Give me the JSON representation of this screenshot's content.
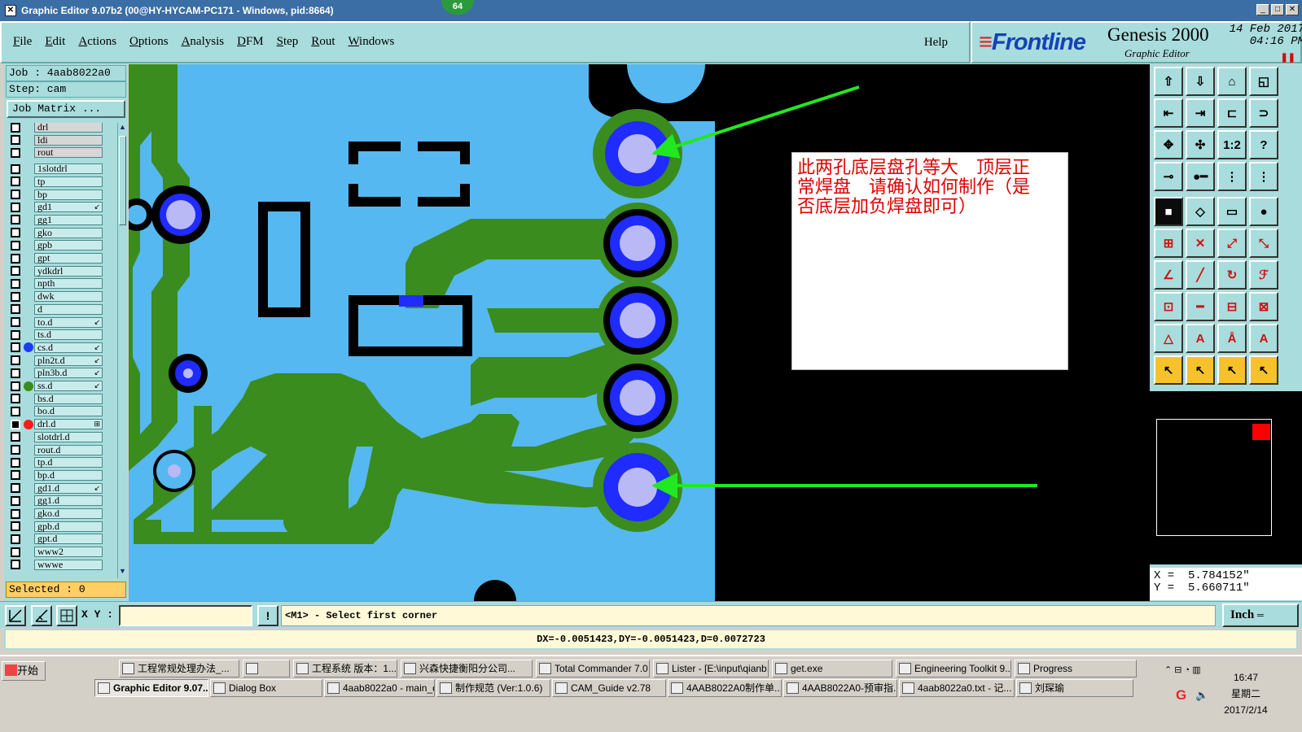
{
  "window": {
    "title": "Graphic Editor 9.07b2 (00@HY-HYCAM-PC171 - Windows, pid:8664)",
    "badge": "64"
  },
  "menu": {
    "items": [
      "File",
      "Edit",
      "Actions",
      "Options",
      "Analysis",
      "DFM",
      "Step",
      "Rout",
      "Windows"
    ],
    "help": "Help"
  },
  "brand": {
    "logo": "Frontline",
    "product": "Genesis 2000",
    "subtitle": "Graphic Editor",
    "date": "14 Feb 2017",
    "time": "04:16 PM",
    "stop_icon": "stop-bars-icon"
  },
  "job": {
    "job_line": "Job : 4aab8022a0",
    "step_line": "Step: cam",
    "matrix_button": "Job Matrix ..."
  },
  "layers": [
    {
      "name": "drl",
      "color": "",
      "flag": "",
      "gray": true
    },
    {
      "name": "ldi",
      "color": "",
      "flag": "",
      "gray": true
    },
    {
      "name": "rout",
      "color": "",
      "flag": "",
      "gray": true
    },
    {
      "name": "1slotdrl",
      "color": "",
      "flag": ""
    },
    {
      "name": "tp",
      "color": "",
      "flag": ""
    },
    {
      "name": "bp",
      "color": "",
      "flag": ""
    },
    {
      "name": "gd1",
      "color": "",
      "flag": "↙"
    },
    {
      "name": "gg1",
      "color": "",
      "flag": ""
    },
    {
      "name": "gko",
      "color": "",
      "flag": ""
    },
    {
      "name": "gpb",
      "color": "",
      "flag": ""
    },
    {
      "name": "gpt",
      "color": "",
      "flag": ""
    },
    {
      "name": "ydkdrl",
      "color": "",
      "flag": ""
    },
    {
      "name": "npth",
      "color": "",
      "flag": ""
    },
    {
      "name": "dwk",
      "color": "",
      "flag": ""
    },
    {
      "name": "d",
      "color": "",
      "flag": ""
    },
    {
      "name": "to.d",
      "color": "",
      "flag": "↙"
    },
    {
      "name": "ts.d",
      "color": "",
      "flag": ""
    },
    {
      "name": "cs.d",
      "color": "#1e3cff",
      "flag": "↙"
    },
    {
      "name": "pln2t.d",
      "color": "",
      "flag": "↙"
    },
    {
      "name": "pln3b.d",
      "color": "",
      "flag": "↙"
    },
    {
      "name": "ss.d",
      "color": "#3a8c1e",
      "flag": "↙"
    },
    {
      "name": "bs.d",
      "color": "",
      "flag": ""
    },
    {
      "name": "bo.d",
      "color": "",
      "flag": ""
    },
    {
      "name": "drl.d",
      "color": "#ff1a1a",
      "flag": "⊞",
      "work": true
    },
    {
      "name": "slotdrl.d",
      "color": "",
      "flag": ""
    },
    {
      "name": "rout.d",
      "color": "",
      "flag": ""
    },
    {
      "name": "tp.d",
      "color": "",
      "flag": ""
    },
    {
      "name": "bp.d",
      "color": "",
      "flag": ""
    },
    {
      "name": "gd1.d",
      "color": "",
      "flag": "↙"
    },
    {
      "name": "gg1.d",
      "color": "",
      "flag": ""
    },
    {
      "name": "gko.d",
      "color": "",
      "flag": ""
    },
    {
      "name": "gpb.d",
      "color": "",
      "flag": ""
    },
    {
      "name": "gpt.d",
      "color": "",
      "flag": ""
    },
    {
      "name": "www2",
      "color": "",
      "flag": ""
    },
    {
      "name": "wwwe",
      "color": "",
      "flag": ""
    }
  ],
  "selected": "Selected : 0",
  "annotation": {
    "line1": "此两孔底层盘孔等大　顶层正",
    "line2": "常焊盘　请确认如何制作（是",
    "line3": "否底层加负焊盘即可）"
  },
  "coords": {
    "x": "X =  5.784152\"",
    "y": "Y =  5.660711\""
  },
  "command": {
    "xy_label": "X Y :",
    "xy_value": "",
    "prompt": "<M1> - Select first corner",
    "units": "Inch"
  },
  "status": "DX=-0.0051423,DY=-0.0051423,D=0.0072723",
  "taskbar": {
    "start": "开始",
    "row1": [
      "工程常规处理办法_...",
      "",
      "工程系统  版本：1...",
      "兴森快捷衡阳分公司...",
      "Total Commander 7.0 ...",
      "Lister - [E:\\input\\qianb...",
      "get.exe",
      "Engineering Toolkit 9....",
      "Progress"
    ],
    "row2": [
      "Graphic Editor 9.07...",
      "Dialog Box",
      "4aab8022a0 - main_qa",
      "制作规范 (Ver:1.0.6)",
      "CAM_Guide v2.78",
      "4AAB8022A0制作单....",
      "4AAB8022A0-预审指...",
      "4aab8022a0.txt - 记...",
      "刘琛瑜"
    ],
    "clock": "16:47",
    "weekday": "星期二",
    "date": "2017/2/14"
  },
  "colors": {
    "board": "#56b8f0",
    "copper": "#3a8c1e",
    "pad": "#1f2bff",
    "hole": "#b9b9f5",
    "arrow": "#21e821",
    "annotation_text": "#e00000"
  }
}
